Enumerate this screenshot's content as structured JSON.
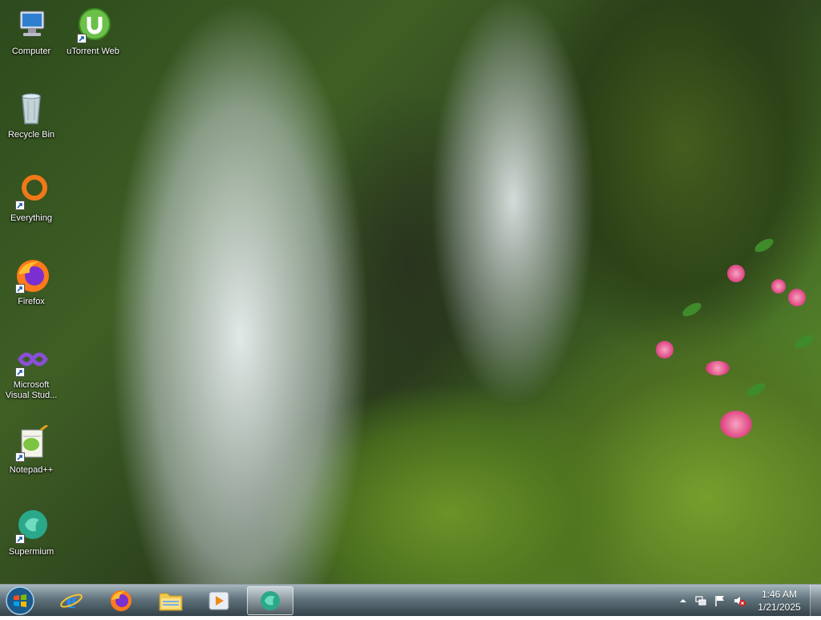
{
  "desktop": {
    "icons": [
      {
        "label": "Computer",
        "icon": "computer-icon",
        "shortcut": false
      },
      {
        "label": "uTorrent Web",
        "icon": "utorrent-web-icon",
        "shortcut": true
      },
      {
        "label": "Recycle Bin",
        "icon": "recycle-bin-icon",
        "shortcut": false
      },
      {
        "label": "Everything",
        "icon": "everything-search-icon",
        "shortcut": true
      },
      {
        "label": "Firefox",
        "icon": "firefox-icon",
        "shortcut": true
      },
      {
        "label": "Microsoft Visual Stud...",
        "icon": "visual-studio-icon",
        "shortcut": true
      },
      {
        "label": "Notepad++",
        "icon": "notepad-plus-plus-icon",
        "shortcut": true
      },
      {
        "label": "Supermium",
        "icon": "supermium-icon",
        "shortcut": true
      }
    ]
  },
  "taskbar": {
    "start": "windows-start-orb-icon",
    "pinned": [
      {
        "name": "internet-explorer-icon"
      },
      {
        "name": "firefox-icon"
      },
      {
        "name": "file-explorer-icon"
      },
      {
        "name": "media-player-icon"
      },
      {
        "name": "supermium-icon",
        "active": true
      }
    ],
    "tray": {
      "icons": [
        "show-hidden-icons-chevron-icon",
        "network-icon",
        "action-center-flag-icon",
        "volume-muted-icon"
      ],
      "time": "1:46 AM",
      "date": "1/21/2025"
    }
  },
  "colors": {
    "moss_green": "#6a9a30",
    "flower_pink": "#e2508a",
    "water_white": "#eaf0f2"
  }
}
